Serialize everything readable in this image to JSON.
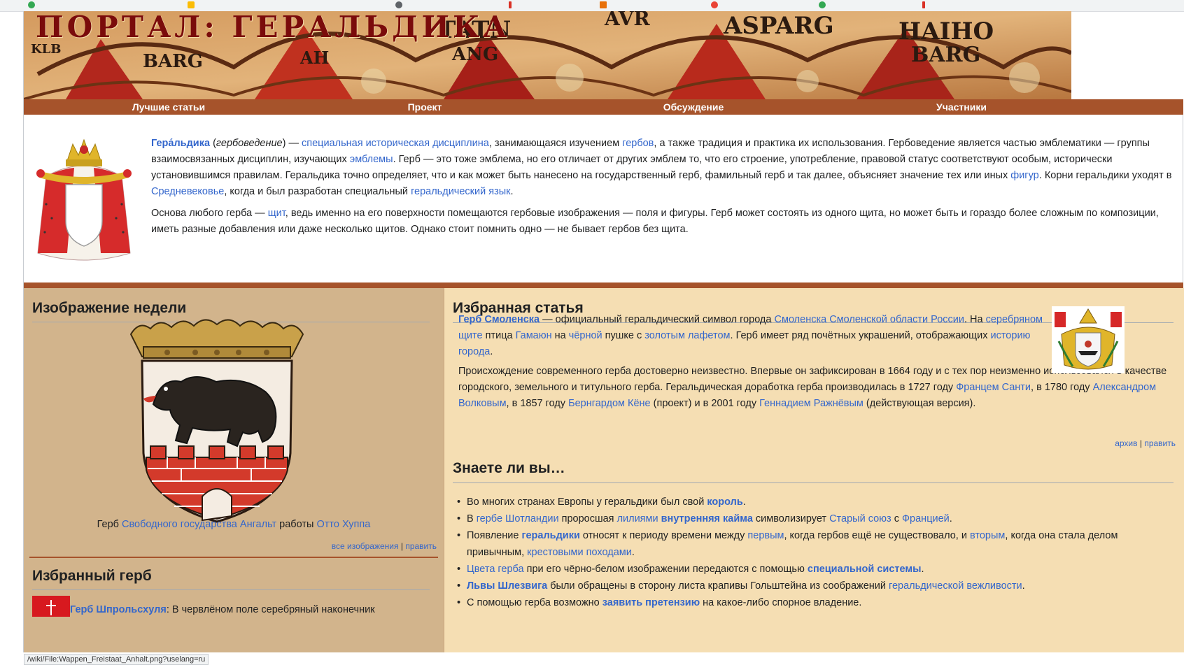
{
  "banner": {
    "title": "ПОРТАЛ: ГЕРАЛЬДИКА"
  },
  "nav": [
    {
      "label": "Лучшие статьи"
    },
    {
      "label": "Проект"
    },
    {
      "label": "Обсуждение"
    },
    {
      "label": "Участники"
    }
  ],
  "intro": {
    "p1": [
      {
        "t": "Гера́льдика",
        "link": true,
        "bold": true
      },
      {
        "t": " (",
        "link": false
      },
      {
        "t": "гербоведение",
        "link": false,
        "italic": true
      },
      {
        "t": ") — ",
        "link": false
      },
      {
        "t": "специальная историческая дисциплина",
        "link": true
      },
      {
        "t": ", занимающаяся изучением ",
        "link": false
      },
      {
        "t": "гербов",
        "link": true
      },
      {
        "t": ", а также традиция и практика их использования. Гербоведение является частью эмблематики — группы взаимосвязанных дисциплин, изучающих ",
        "link": false
      },
      {
        "t": "эмблемы",
        "link": true
      },
      {
        "t": ". Герб — это тоже эмблема, но его отличает от других эмблем то, что его строение, употребление, правовой статус соответствуют особым, исторически установившимся правилам. Геральдика точно определяет, что и как может быть нанесено на государственный герб, фамильный герб и так далее, объясняет значение тех или иных ",
        "link": false
      },
      {
        "t": "фигур",
        "link": true
      },
      {
        "t": ". Корни геральдики уходят в ",
        "link": false
      },
      {
        "t": "Средневековье",
        "link": true
      },
      {
        "t": ", когда и был разработан специальный ",
        "link": false
      },
      {
        "t": "геральдический язык",
        "link": true
      },
      {
        "t": ".",
        "link": false
      }
    ],
    "p2": [
      {
        "t": "Основа любого герба — ",
        "link": false
      },
      {
        "t": "щит",
        "link": true
      },
      {
        "t": ", ведь именно на его поверхности помещаются гербовые изображения — поля и фигуры. Герб может состоять из одного щита, но может быть и гораздо более сложным по композиции, иметь разные добавления или даже несколько щитов. Однако стоит помнить одно — не бывает гербов без щита.",
        "link": false
      }
    ]
  },
  "week": {
    "heading": "Изображение недели",
    "caption": [
      {
        "t": "Герб ",
        "link": false
      },
      {
        "t": "Свободного государства Ангальт",
        "link": true
      },
      {
        "t": " работы ",
        "link": false
      },
      {
        "t": "Отто Хуппа",
        "link": true
      }
    ],
    "link_all": "все изображения",
    "sep": "|",
    "link_edit": "править"
  },
  "arms": {
    "heading": "Избранный герб",
    "text_link": "Герб Шпрольсхуля",
    "text_rest": ": В червлёном поле серебряный наконечник"
  },
  "featured": {
    "heading": "Избранная статья",
    "p1": [
      {
        "t": "Герб Смоленска",
        "link": true,
        "bold": true
      },
      {
        "t": " — официальный геральдический символ города ",
        "link": false
      },
      {
        "t": "Смоленска",
        "link": true
      },
      {
        "t": " ",
        "link": false
      },
      {
        "t": "Смоленской области",
        "link": true
      },
      {
        "t": " ",
        "link": false
      },
      {
        "t": "России",
        "link": true
      },
      {
        "t": ". На ",
        "link": false
      },
      {
        "t": "серебряном щите",
        "link": true
      },
      {
        "t": " птица ",
        "link": false
      },
      {
        "t": "Гамаюн",
        "link": true
      },
      {
        "t": " на ",
        "link": false
      },
      {
        "t": "чёрной",
        "link": true
      },
      {
        "t": " пушке с ",
        "link": false
      },
      {
        "t": "золотым",
        "link": true
      },
      {
        "t": " ",
        "link": false
      },
      {
        "t": "лафетом",
        "link": true
      },
      {
        "t": ". Герб имеет ряд почётных украшений, отображающих ",
        "link": false
      },
      {
        "t": "историю города",
        "link": true
      },
      {
        "t": ".",
        "link": false
      }
    ],
    "p2": [
      {
        "t": "Происхождение современного герба достоверно неизвестно. Впервые он зафиксирован в 1664 году и с тех пор неизменно использовался в качестве городского, земельного и титульного герба. Геральдическая доработка герба производилась в 1727 году ",
        "link": false
      },
      {
        "t": "Францем Санти",
        "link": true
      },
      {
        "t": ", в 1780 году ",
        "link": false
      },
      {
        "t": "Александром Волковым",
        "link": true
      },
      {
        "t": ", в 1857 году ",
        "link": false
      },
      {
        "t": "Бернгардом Кёне",
        "link": true
      },
      {
        "t": " (проект) и в 2001 году ",
        "link": false
      },
      {
        "t": "Геннадием Ражнёвым",
        "link": true
      },
      {
        "t": " (действующая версия).",
        "link": false
      }
    ],
    "link_archive": "архив",
    "sep": "|",
    "link_edit": "править"
  },
  "dyk": {
    "heading": "Знаете ли вы…",
    "items": [
      [
        {
          "t": "Во многих странах Европы у геральдики был свой ",
          "link": false
        },
        {
          "t": "король",
          "link": true,
          "bold": true
        },
        {
          "t": ".",
          "link": false
        }
      ],
      [
        {
          "t": "В ",
          "link": false
        },
        {
          "t": "гербе Шотландии",
          "link": true
        },
        {
          "t": " проросшая ",
          "link": false
        },
        {
          "t": "лилиями",
          "link": true
        },
        {
          "t": " ",
          "link": false
        },
        {
          "t": "внутренняя кайма",
          "link": true,
          "bold": true
        },
        {
          "t": " символизирует ",
          "link": false
        },
        {
          "t": "Старый союз",
          "link": true
        },
        {
          "t": " с ",
          "link": false
        },
        {
          "t": "Францией",
          "link": true
        },
        {
          "t": ".",
          "link": false
        }
      ],
      [
        {
          "t": "Появление ",
          "link": false
        },
        {
          "t": "геральдики",
          "link": true,
          "bold": true
        },
        {
          "t": " относят к периоду времени между ",
          "link": false
        },
        {
          "t": "первым",
          "link": true
        },
        {
          "t": ", когда гербов ещё не существовало, и ",
          "link": false
        },
        {
          "t": "вторым",
          "link": true
        },
        {
          "t": ", когда она стала делом привычным, ",
          "link": false
        },
        {
          "t": "крестовыми походами",
          "link": true
        },
        {
          "t": ".",
          "link": false
        }
      ],
      [
        {
          "t": "Цвета герба",
          "link": true
        },
        {
          "t": " при его чёрно-белом изображении передаются с помощью ",
          "link": false
        },
        {
          "t": "специальной системы",
          "link": true,
          "bold": true
        },
        {
          "t": ".",
          "link": false
        }
      ],
      [
        {
          "t": "Львы Шлезвига",
          "link": true,
          "bold": true
        },
        {
          "t": " были обращены в сторону листа крапивы Гольштейна из соображений ",
          "link": false
        },
        {
          "t": "геральдической вежливости",
          "link": true
        },
        {
          "t": ".",
          "link": false
        }
      ],
      [
        {
          "t": "С помощью герба возможно ",
          "link": false
        },
        {
          "t": "заявить претензию",
          "link": true,
          "bold": true
        },
        {
          "t": " на какое-либо спорное владение.",
          "link": false
        }
      ]
    ]
  },
  "status": {
    "url": "/wiki/File:Wappen_Freistaat_Anhalt.png?uselang=ru"
  },
  "colors": {
    "banner_bar": "#a6532b",
    "left_bg": "#d2b48c",
    "right_bg": "#f5deb3",
    "link": "#3366cc"
  }
}
